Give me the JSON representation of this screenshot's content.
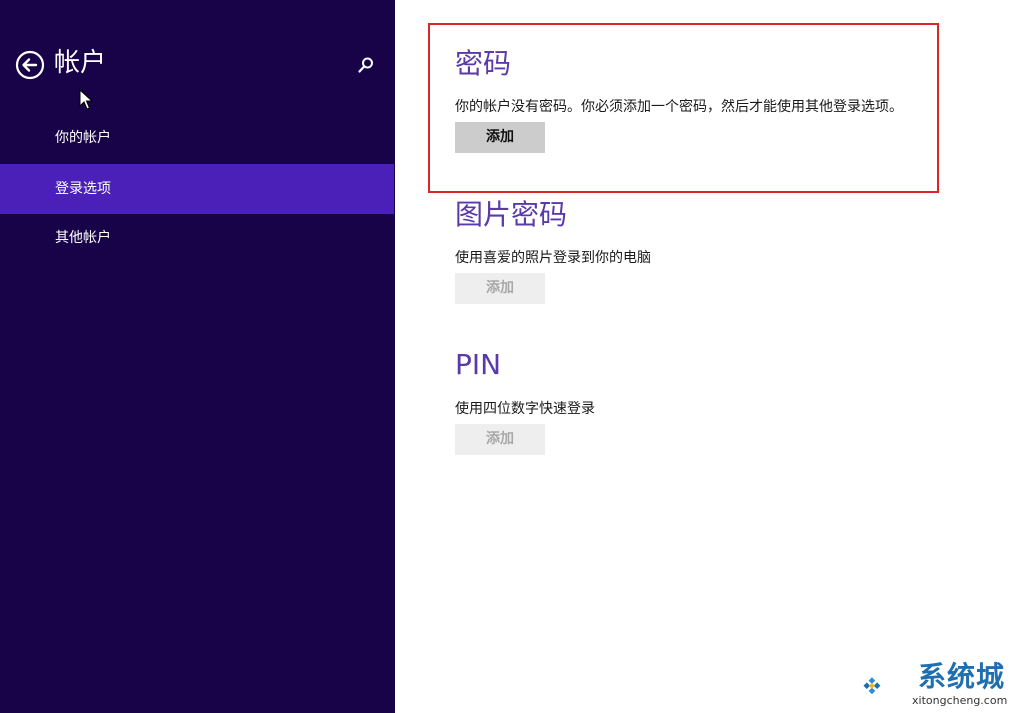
{
  "sidebar": {
    "title": "帐户",
    "items": [
      {
        "label": "你的帐户",
        "active": false
      },
      {
        "label": "登录选项",
        "active": true
      },
      {
        "label": "其他帐户",
        "active": false
      }
    ]
  },
  "sections": {
    "password": {
      "title": "密码",
      "description": "你的帐户没有密码。你必须添加一个密码，然后才能使用其他登录选项。",
      "button": "添加"
    },
    "picture_password": {
      "title": "图片密码",
      "description": "使用喜爱的照片登录到你的电脑",
      "button": "添加"
    },
    "pin": {
      "title": "PIN",
      "description": "使用四位数字快速登录",
      "button": "添加"
    }
  },
  "watermark": {
    "brand": "系统城",
    "url": "xitongcheng.com"
  },
  "colors": {
    "sidebar_bg": "#180349",
    "active_item": "#4b20b8",
    "heading": "#5a3aa8",
    "highlight_border": "#d9262c"
  },
  "icons": [
    "back-arrow-icon",
    "search-icon",
    "mouse-cursor-icon",
    "logo-icon"
  ]
}
